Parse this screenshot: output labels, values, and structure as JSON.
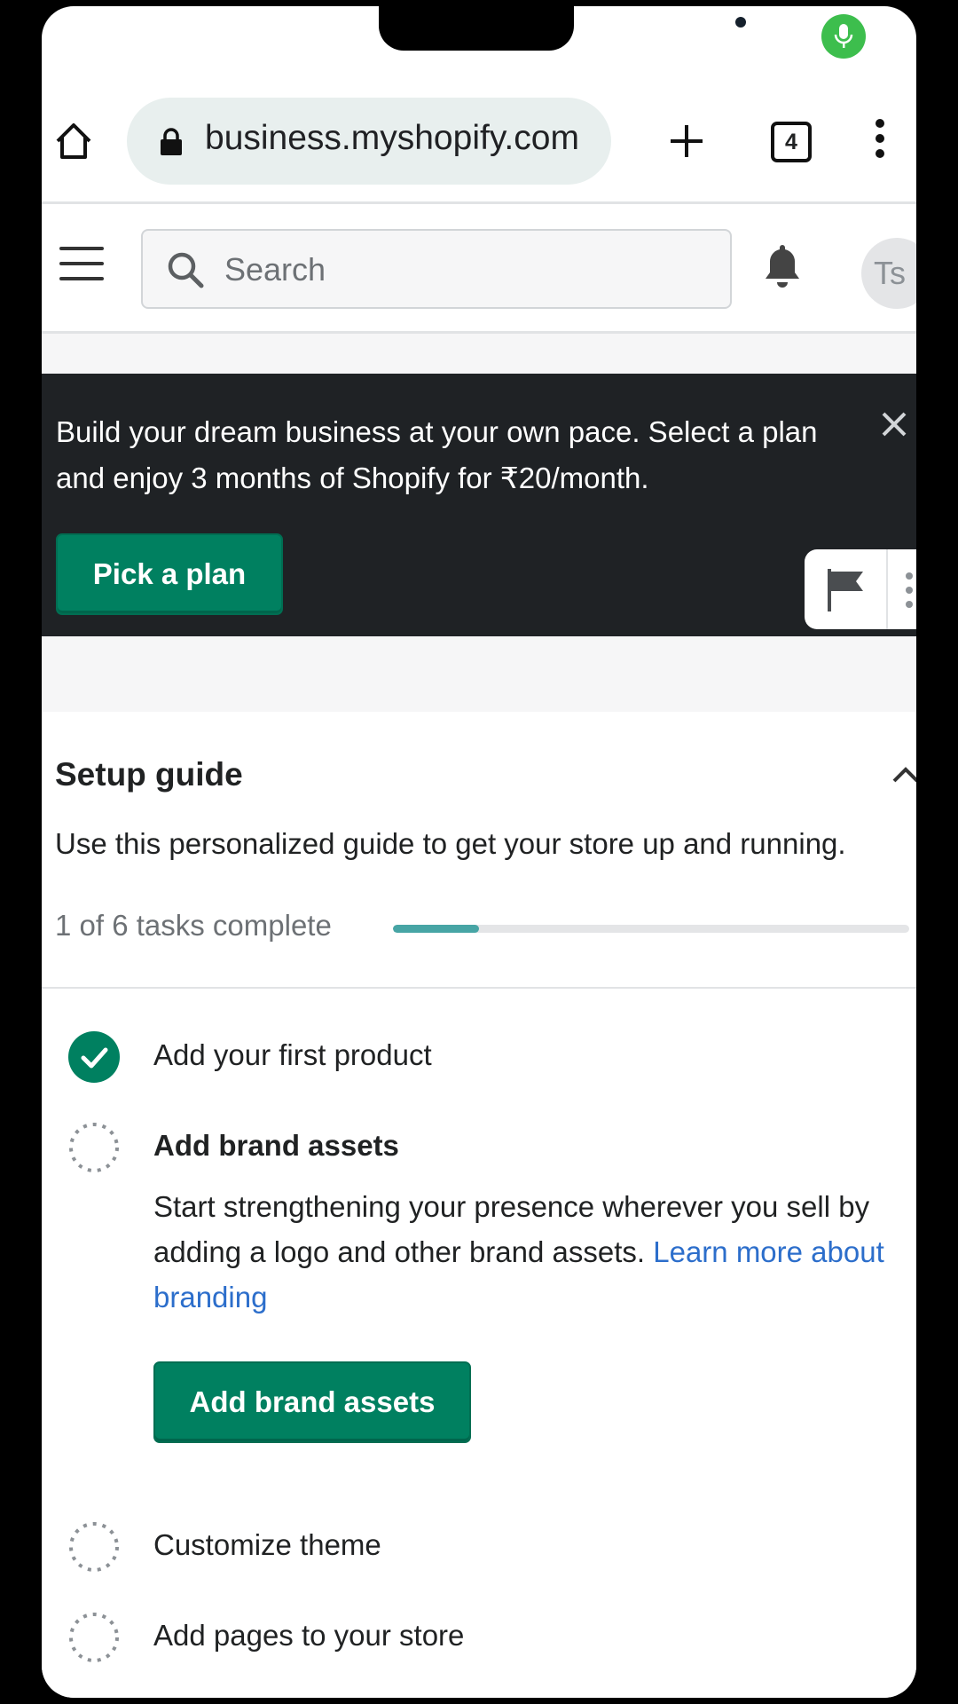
{
  "browser": {
    "url": "business.myshopify.com",
    "tab_count": "4"
  },
  "topbar": {
    "search_placeholder": "Search",
    "avatar_initials": "Ts"
  },
  "banner": {
    "message": "Build your dream business at your own pace. Select a plan and enjoy 3 months of Shopify for ₹20/month.",
    "cta_label": "Pick a plan"
  },
  "setup_guide": {
    "title": "Setup guide",
    "description": "Use this personalized guide to get your store up and running.",
    "progress_label": "1 of 6 tasks complete",
    "progress_fraction": 0.167,
    "tasks": [
      {
        "label": "Add your first product",
        "completed": true
      },
      {
        "label": "Add brand assets",
        "completed": false,
        "expanded": true,
        "description": "Start strengthening your presence wherever you sell by adding a logo and other brand assets.",
        "link_text": "Learn more about branding",
        "button_label": "Add brand assets"
      },
      {
        "label": "Customize theme",
        "completed": false
      },
      {
        "label": "Add pages to your store",
        "completed": false
      }
    ]
  },
  "colors": {
    "primary_green": "#008060",
    "banner_bg": "#1f2225",
    "progress_fill": "#47a5a5",
    "link": "#2c6ecb"
  }
}
